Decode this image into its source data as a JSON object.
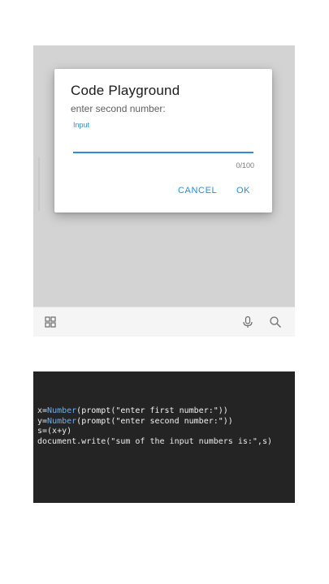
{
  "dialog": {
    "title": "Code Playground",
    "message": "enter second number:",
    "input_label": "Input",
    "input_value": "",
    "counter": "0/100",
    "cancel_label": "CANCEL",
    "ok_label": "OK"
  },
  "toolbar": {
    "icons": [
      "grid-icon",
      "microphone-icon",
      "search-icon"
    ]
  },
  "code": {
    "line1": {
      "var": "x=",
      "fn": "Number",
      "rest": "(prompt(\"enter first number:\"))"
    },
    "line2": {
      "var": "y=",
      "fn": "Number",
      "rest": "(prompt(\"enter second number:\"))"
    },
    "line3": "s=(x+y)",
    "line4": "document.write(\"sum of the input numbers is:\",s)"
  },
  "colors": {
    "accent": "#2c8ad6",
    "overlay": "#d3d3d3",
    "code_bg": "#242424",
    "keyword": "#6cb0f0"
  }
}
